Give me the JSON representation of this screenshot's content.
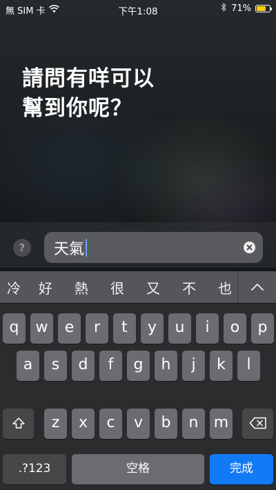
{
  "status_bar": {
    "carrier": "無 SIM 卡",
    "time": "下午1:08",
    "battery_percent": "71%",
    "battery_level": 0.71,
    "battery_color": "#ffcc00",
    "icons": [
      "wifi-icon",
      "bluetooth-icon",
      "battery-icon"
    ]
  },
  "siri": {
    "prompt_line1": "請問有咩可以",
    "prompt_line2": "幫到你呢？",
    "help_icon": "?"
  },
  "input": {
    "value": "天氣",
    "clear_icon": "clear-icon"
  },
  "candidates": {
    "items": [
      "冷",
      "好",
      "熱",
      "很",
      "又",
      "不",
      "也"
    ],
    "expand_icon": "chevron-up-icon"
  },
  "keyboard": {
    "row1": [
      "q",
      "w",
      "e",
      "r",
      "t",
      "y",
      "u",
      "i",
      "o",
      "p"
    ],
    "row2": [
      "a",
      "s",
      "d",
      "f",
      "g",
      "h",
      "j",
      "k",
      "l"
    ],
    "row3": [
      "z",
      "x",
      "c",
      "v",
      "b",
      "n",
      "m"
    ],
    "numbers_label": ".?123",
    "space_label": "空格",
    "done_label": "完成",
    "accent_color": "#137af6"
  }
}
